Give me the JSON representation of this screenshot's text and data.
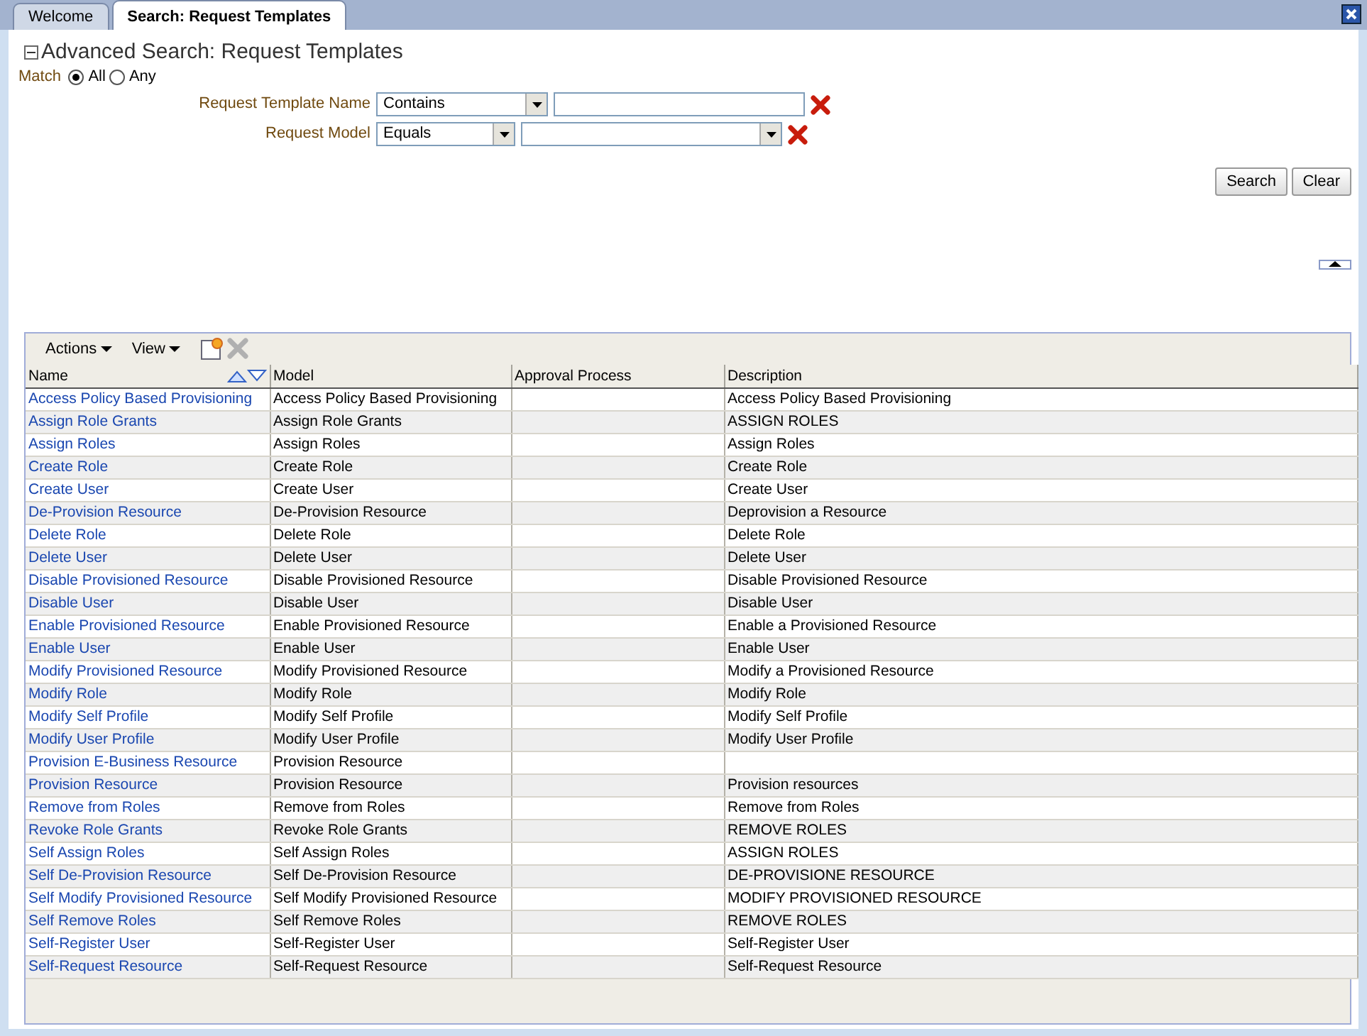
{
  "tabs": [
    {
      "label": "Welcome",
      "selected": false
    },
    {
      "label": "Search: Request Templates",
      "selected": true
    }
  ],
  "search": {
    "title": "Advanced Search: Request Templates",
    "expanded": true,
    "match_label": "Match",
    "match_options": [
      {
        "label": "All",
        "selected": true
      },
      {
        "label": "Any",
        "selected": false
      }
    ],
    "fields": [
      {
        "label": "Request Template Name",
        "operator": "Contains",
        "kind": "text"
      },
      {
        "label": "Request Model",
        "operator": "Equals",
        "kind": "select"
      }
    ],
    "buttons": [
      "Search",
      "Clear"
    ]
  },
  "toolbar": {
    "menus": [
      "Actions",
      "View"
    ]
  },
  "table": {
    "columns": [
      "Name",
      "Model",
      "Approval Process",
      "Description"
    ],
    "rows": [
      {
        "name": "Access Policy Based Provisioning",
        "model": "Access Policy Based Provisioning",
        "description": "Access Policy Based Provisioning"
      },
      {
        "name": "Assign Role Grants",
        "model": "Assign Role Grants",
        "description": "ASSIGN ROLES"
      },
      {
        "name": "Assign Roles",
        "model": "Assign Roles",
        "description": "Assign Roles"
      },
      {
        "name": "Create Role",
        "model": "Create Role",
        "description": "Create Role"
      },
      {
        "name": "Create User",
        "model": "Create User",
        "description": "Create User"
      },
      {
        "name": "De-Provision Resource",
        "model": "De-Provision Resource",
        "description": "Deprovision a Resource"
      },
      {
        "name": "Delete Role",
        "model": "Delete Role",
        "description": "Delete Role"
      },
      {
        "name": "Delete User",
        "model": "Delete User",
        "description": "Delete User"
      },
      {
        "name": "Disable Provisioned Resource",
        "model": "Disable Provisioned Resource",
        "description": "Disable Provisioned Resource"
      },
      {
        "name": "Disable User",
        "model": "Disable User",
        "description": "Disable User"
      },
      {
        "name": "Enable Provisioned Resource",
        "model": "Enable Provisioned Resource",
        "description": "Enable a Provisioned Resource"
      },
      {
        "name": "Enable User",
        "model": "Enable User",
        "description": "Enable User"
      },
      {
        "name": "Modify Provisioned Resource",
        "model": "Modify Provisioned Resource",
        "description": "Modify a Provisioned Resource"
      },
      {
        "name": "Modify Role",
        "model": "Modify Role",
        "description": "Modify Role"
      },
      {
        "name": "Modify Self Profile",
        "model": "Modify Self Profile",
        "description": "Modify Self Profile"
      },
      {
        "name": "Modify User Profile",
        "model": "Modify User Profile",
        "description": "Modify User Profile"
      },
      {
        "name": "Provision E-Business Resource",
        "model": "Provision Resource"
      },
      {
        "name": "Provision Resource",
        "model": "Provision Resource",
        "description": "Provision resources"
      },
      {
        "name": "Remove from Roles",
        "model": "Remove from Roles",
        "description": "Remove from Roles"
      },
      {
        "name": "Revoke Role Grants",
        "model": "Revoke Role Grants",
        "description": "REMOVE ROLES"
      },
      {
        "name": "Self Assign Roles",
        "model": "Self Assign Roles",
        "description": "ASSIGN ROLES"
      },
      {
        "name": "Self De-Provision Resource",
        "model": "Self De-Provision Resource",
        "description": "DE-PROVISIONE RESOURCE"
      },
      {
        "name": "Self Modify Provisioned Resource",
        "model": "Self Modify Provisioned Resource",
        "description": "MODIFY PROVISIONED RESOURCE"
      },
      {
        "name": "Self Remove Roles",
        "model": "Self Remove Roles",
        "description": "REMOVE ROLES"
      },
      {
        "name": "Self-Register User",
        "model": "Self-Register User",
        "description": "Self-Register User"
      },
      {
        "name": "Self-Request Resource",
        "model": "Self-Request Resource",
        "description": "Self-Request Resource"
      }
    ]
  }
}
